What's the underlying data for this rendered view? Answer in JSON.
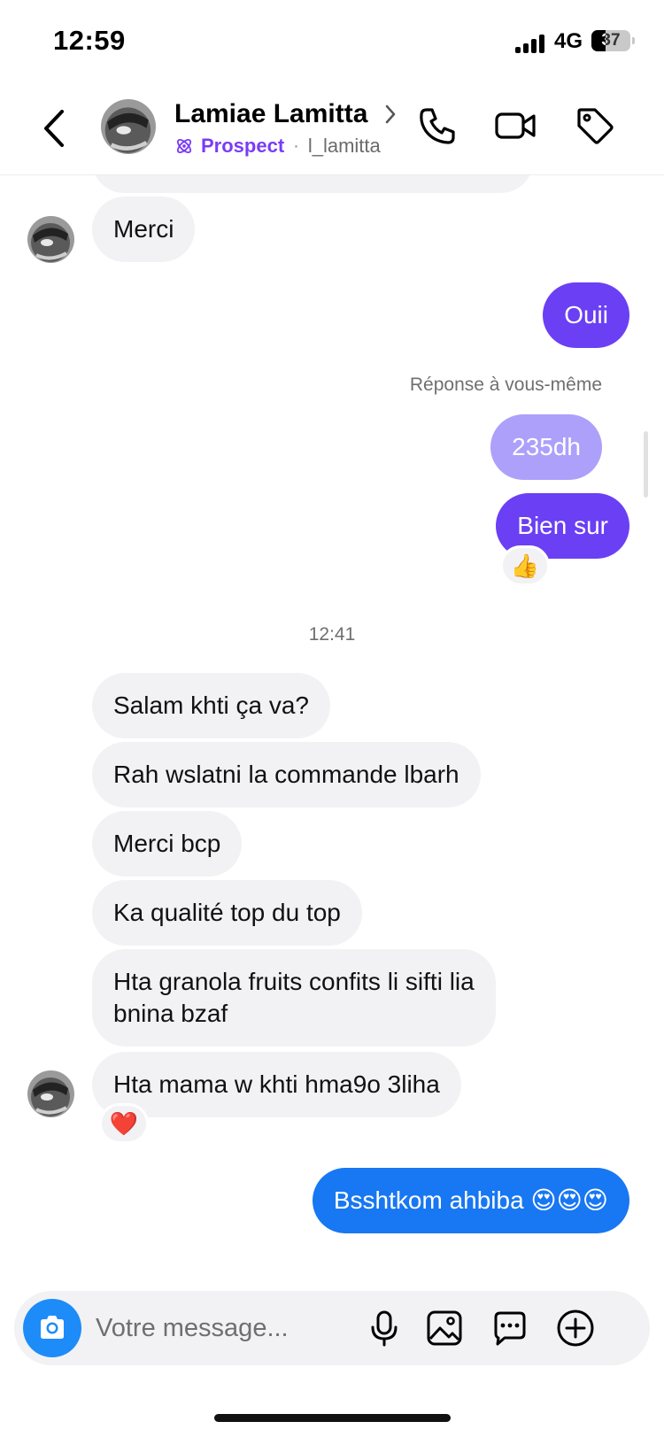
{
  "status_bar": {
    "time": "12:59",
    "network": "4G",
    "battery": "37",
    "battery_level": 0.37
  },
  "header": {
    "name": "Lamiae Lamitta",
    "label": "Prospect",
    "separator": "·",
    "username": "l_lamitta"
  },
  "messages": {
    "merci": "Merci",
    "ouii": "Ouii",
    "reply_note": "Réponse à vous-même",
    "price": "235dh",
    "bien_sur": "Bien sur",
    "reaction_thumbs": "👍",
    "time_divider": "12:41",
    "m1": "Salam khti ça va?",
    "m2": "Rah wslatni la commande lbarh",
    "m3": "Merci bcp",
    "m4": "Ka qualité top du top",
    "m5_line1": "Hta granola fruits confits li sifti lia",
    "m5_line2": "bnina bzaf",
    "m6": "Hta mama w khti hma9o 3liha",
    "reaction_heart": "❤️",
    "last_sent": "Bsshtkom ahbiba 😍😍😍"
  },
  "composer": {
    "placeholder": "Votre message..."
  },
  "colors": {
    "sent_purple": "#6b3ff4",
    "sent_blue": "#1877f2",
    "received": "#f2f2f4",
    "prospect": "#7a3cf5"
  }
}
